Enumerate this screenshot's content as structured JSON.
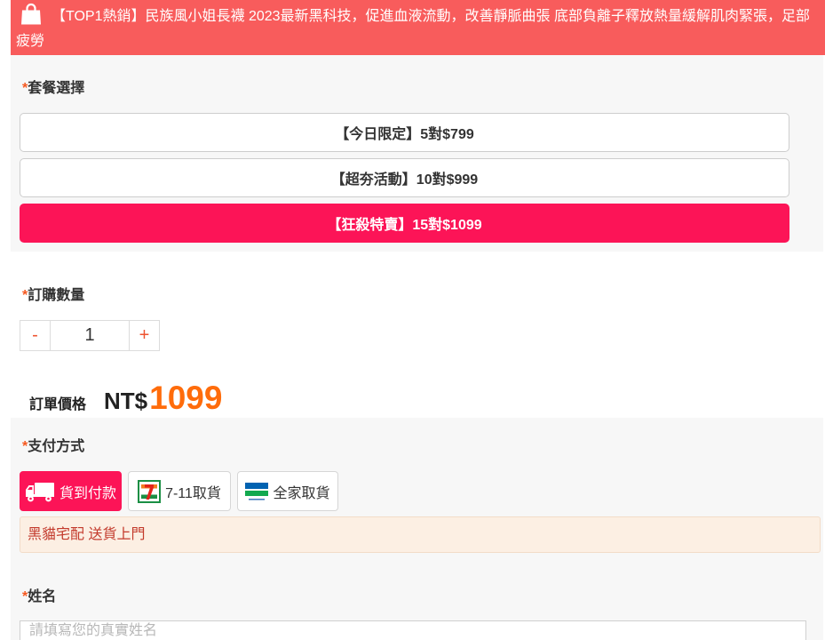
{
  "banner": {
    "icon": "shopping-bag-icon",
    "text": "【TOP1熱銷】民族風小姐長襪 2023最新黑科技，促進血液流動，改善靜脈曲張 底部負離子釋放熱量緩解肌肉緊張，足部疲勞"
  },
  "package": {
    "required_mark": "*",
    "label": "套餐選擇",
    "options": [
      {
        "label": "【今日限定】5對$799",
        "selected": false
      },
      {
        "label": "【超夯活動】10對$999",
        "selected": false
      },
      {
        "label": "【狂殺特賣】15對$1099",
        "selected": true
      }
    ]
  },
  "quantity": {
    "required_mark": "*",
    "label": "訂購數量",
    "decrement_label": "-",
    "value": "1",
    "increment_label": "+"
  },
  "price": {
    "label": "訂單價格",
    "currency": "NT$",
    "amount": "1099"
  },
  "payment": {
    "required_mark": "*",
    "label": "支付方式",
    "methods": [
      {
        "label": "貨到付款",
        "icon": "truck-icon",
        "selected": true
      },
      {
        "label": "7-11取貨",
        "icon": "seven-eleven-logo-icon",
        "logo_text": "7",
        "selected": false
      },
      {
        "label": "全家取貨",
        "icon": "familymart-logo-icon",
        "logo_text": "FamilyMart",
        "selected": false
      }
    ],
    "notice": "黑貓宅配 送貨上門"
  },
  "name": {
    "required_mark": "*",
    "label": "姓名",
    "placeholder": "請填寫您的真實姓名"
  },
  "colors": {
    "banner": "#f85c5c",
    "accent": "#fc1457",
    "required": "#f5581f",
    "price": "#ff6c0b",
    "notice_bg": "#fcefe3",
    "notice_text": "#c33a2c",
    "section_bg": "#f7f7f7",
    "stepper": "#ee5330"
  }
}
